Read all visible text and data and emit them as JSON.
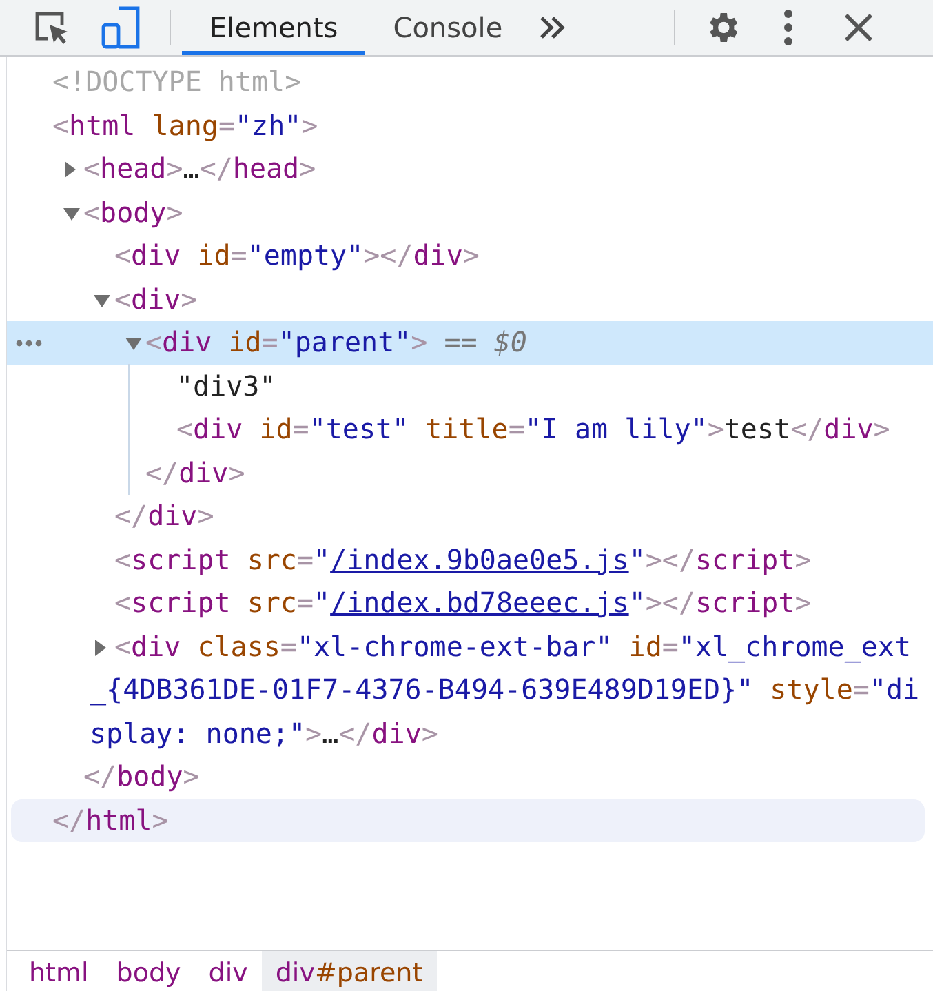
{
  "toolbar": {
    "tabs": [
      {
        "label": "Elements",
        "selected": true
      },
      {
        "label": "Console",
        "selected": false
      }
    ]
  },
  "tree": [
    {
      "selected": false,
      "tokens": [
        {
          "kind": "doctype",
          "text": "<!DOCTYPE html>"
        }
      ]
    },
    {
      "selected": false,
      "tokens": [
        {
          "kind": "punct",
          "text": "<"
        },
        {
          "kind": "tag",
          "text": "html"
        },
        {
          "kind": "attr",
          "text": " lang"
        },
        {
          "kind": "punct",
          "text": "="
        },
        {
          "kind": "value",
          "text": "\"zh\""
        },
        {
          "kind": "punct",
          "text": ">"
        }
      ],
      "children": [
        {
          "selected": false,
          "expanded": false,
          "tokens": [
            {
              "kind": "punct",
              "text": "<"
            },
            {
              "kind": "tag",
              "text": "head"
            },
            {
              "kind": "punct",
              "text": ">"
            },
            {
              "kind": "plain",
              "text": "…"
            },
            {
              "kind": "punct",
              "text": "</"
            },
            {
              "kind": "tag",
              "text": "head"
            },
            {
              "kind": "punct",
              "text": ">"
            }
          ]
        },
        {
          "selected": false,
          "expanded": true,
          "tokens": [
            {
              "kind": "punct",
              "text": "<"
            },
            {
              "kind": "tag",
              "text": "body"
            },
            {
              "kind": "punct",
              "text": ">"
            }
          ],
          "children": [
            {
              "selected": false,
              "tokens": [
                {
                  "kind": "punct",
                  "text": "<"
                },
                {
                  "kind": "tag",
                  "text": "div"
                },
                {
                  "kind": "attr",
                  "text": " id"
                },
                {
                  "kind": "punct",
                  "text": "="
                },
                {
                  "kind": "value",
                  "text": "\"empty\""
                },
                {
                  "kind": "punct",
                  "text": "></"
                },
                {
                  "kind": "tag",
                  "text": "div"
                },
                {
                  "kind": "punct",
                  "text": ">"
                }
              ]
            },
            {
              "selected": false,
              "expanded": true,
              "tokens": [
                {
                  "kind": "punct",
                  "text": "<"
                },
                {
                  "kind": "tag",
                  "text": "div"
                },
                {
                  "kind": "punct",
                  "text": ">"
                }
              ],
              "children": [
                {
                  "selected": true,
                  "expanded": true,
                  "tokens": [
                    {
                      "kind": "punct",
                      "text": "<"
                    },
                    {
                      "kind": "tag",
                      "text": "div"
                    },
                    {
                      "kind": "attr",
                      "text": " id"
                    },
                    {
                      "kind": "punct",
                      "text": "="
                    },
                    {
                      "kind": "value",
                      "text": "\"parent\""
                    },
                    {
                      "kind": "punct",
                      "text": ">"
                    },
                    {
                      "kind": "ref",
                      "text": " == "
                    },
                    {
                      "kind": "refvar",
                      "text": "$0"
                    }
                  ],
                  "children": [
                    {
                      "selected": false,
                      "tokens": [
                        {
                          "kind": "plain",
                          "text": "\"div3\""
                        }
                      ]
                    },
                    {
                      "selected": false,
                      "tokens": [
                        {
                          "kind": "punct",
                          "text": "<"
                        },
                        {
                          "kind": "tag",
                          "text": "div"
                        },
                        {
                          "kind": "attr",
                          "text": " id"
                        },
                        {
                          "kind": "punct",
                          "text": "="
                        },
                        {
                          "kind": "value",
                          "text": "\"test\""
                        },
                        {
                          "kind": "attr",
                          "text": " title"
                        },
                        {
                          "kind": "punct",
                          "text": "="
                        },
                        {
                          "kind": "value",
                          "text": "\"I am lily\""
                        },
                        {
                          "kind": "punct",
                          "text": ">"
                        },
                        {
                          "kind": "plain",
                          "text": "test"
                        },
                        {
                          "kind": "punct",
                          "text": "</"
                        },
                        {
                          "kind": "tag",
                          "text": "div"
                        },
                        {
                          "kind": "punct",
                          "text": ">"
                        }
                      ]
                    }
                  ],
                  "closing": {
                    "hovered": false,
                    "tokens": [
                      {
                        "kind": "punct",
                        "text": "</"
                      },
                      {
                        "kind": "tag",
                        "text": "div"
                      },
                      {
                        "kind": "punct",
                        "text": ">"
                      }
                    ]
                  }
                }
              ],
              "closing": {
                "hovered": false,
                "tokens": [
                  {
                    "kind": "punct",
                    "text": "</"
                  },
                  {
                    "kind": "tag",
                    "text": "div"
                  },
                  {
                    "kind": "punct",
                    "text": ">"
                  }
                ]
              }
            },
            {
              "selected": false,
              "tokens": [
                {
                  "kind": "punct",
                  "text": "<"
                },
                {
                  "kind": "tag",
                  "text": "script"
                },
                {
                  "kind": "attr",
                  "text": " src"
                },
                {
                  "kind": "punct",
                  "text": "="
                },
                {
                  "kind": "value",
                  "text": "\""
                },
                {
                  "kind": "link",
                  "text": "/index.9b0ae0e5.js"
                },
                {
                  "kind": "value",
                  "text": "\""
                },
                {
                  "kind": "punct",
                  "text": "></"
                },
                {
                  "kind": "tag",
                  "text": "script"
                },
                {
                  "kind": "punct",
                  "text": ">"
                }
              ]
            },
            {
              "selected": false,
              "tokens": [
                {
                  "kind": "punct",
                  "text": "<"
                },
                {
                  "kind": "tag",
                  "text": "script"
                },
                {
                  "kind": "attr",
                  "text": " src"
                },
                {
                  "kind": "punct",
                  "text": "="
                },
                {
                  "kind": "value",
                  "text": "\""
                },
                {
                  "kind": "link",
                  "text": "/index.bd78eeec.js"
                },
                {
                  "kind": "value",
                  "text": "\""
                },
                {
                  "kind": "punct",
                  "text": "></"
                },
                {
                  "kind": "tag",
                  "text": "script"
                },
                {
                  "kind": "punct",
                  "text": ">"
                }
              ]
            },
            {
              "selected": false,
              "expanded": false,
              "tokens": [
                {
                  "kind": "punct",
                  "text": "<"
                },
                {
                  "kind": "tag",
                  "text": "div"
                },
                {
                  "kind": "attr",
                  "text": " class"
                },
                {
                  "kind": "punct",
                  "text": "="
                },
                {
                  "kind": "value",
                  "text": "\"xl-chrome-ext-bar\""
                },
                {
                  "kind": "attr",
                  "text": " id"
                },
                {
                  "kind": "punct",
                  "text": "="
                },
                {
                  "kind": "value",
                  "text": "\"xl_chrome_ext_{4DB361DE-01F7-4376-B494-639E489D19ED}\""
                },
                {
                  "kind": "attr",
                  "text": " style"
                },
                {
                  "kind": "punct",
                  "text": "="
                },
                {
                  "kind": "value",
                  "text": "\"display: none;\""
                },
                {
                  "kind": "punct",
                  "text": ">"
                },
                {
                  "kind": "plain",
                  "text": "…"
                },
                {
                  "kind": "punct",
                  "text": "</"
                },
                {
                  "kind": "tag",
                  "text": "div"
                },
                {
                  "kind": "punct",
                  "text": ">"
                }
              ]
            }
          ],
          "closing": {
            "hovered": false,
            "tokens": [
              {
                "kind": "punct",
                "text": "</"
              },
              {
                "kind": "tag",
                "text": "body"
              },
              {
                "kind": "punct",
                "text": ">"
              }
            ]
          }
        }
      ],
      "closing": {
        "hovered": true,
        "tokens": [
          {
            "kind": "punct",
            "text": "</"
          },
          {
            "kind": "tag",
            "text": "html"
          },
          {
            "kind": "punct",
            "text": ">"
          }
        ]
      }
    }
  ],
  "breadcrumbs": [
    {
      "tag": "html",
      "selected": false
    },
    {
      "tag": "body",
      "selected": false
    },
    {
      "tag": "div",
      "selected": false
    },
    {
      "tag": "div",
      "id": "#parent",
      "selected": true
    }
  ]
}
